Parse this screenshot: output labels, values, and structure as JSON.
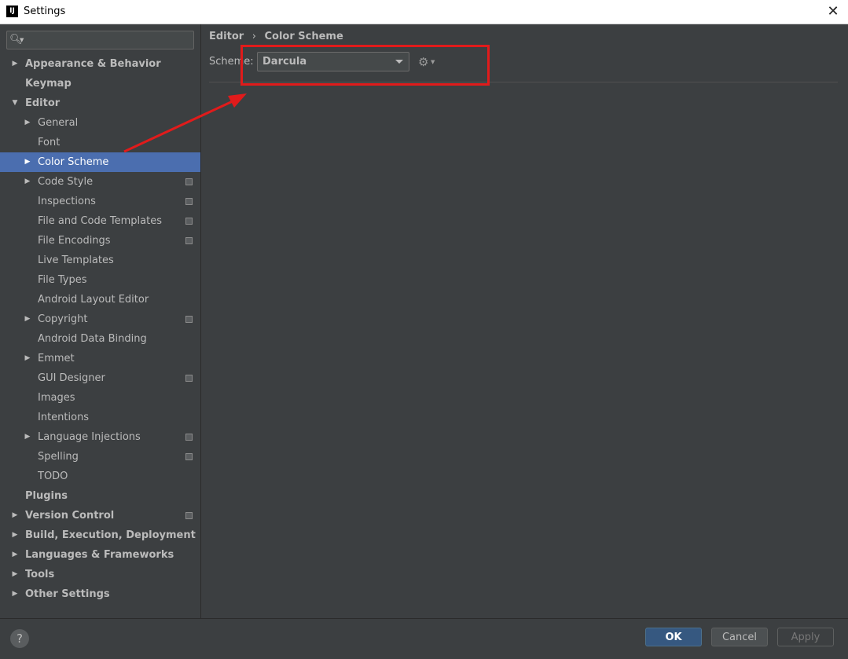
{
  "window": {
    "title": "Settings",
    "app_icon_text": "IJ",
    "close_glyph": "✕"
  },
  "search": {
    "value": "",
    "icon": "search-icon"
  },
  "tree": [
    {
      "label": "Appearance & Behavior",
      "level": 0,
      "bold": true,
      "expander": "collapsed"
    },
    {
      "label": "Keymap",
      "level": 0,
      "bold": true,
      "expander": "none"
    },
    {
      "label": "Editor",
      "level": 0,
      "bold": true,
      "expander": "expanded"
    },
    {
      "label": "General",
      "level": 1,
      "expander": "collapsed"
    },
    {
      "label": "Font",
      "level": 1,
      "expander": "none"
    },
    {
      "label": "Color Scheme",
      "level": 1,
      "expander": "collapsed",
      "selected": true
    },
    {
      "label": "Code Style",
      "level": 1,
      "expander": "collapsed",
      "project": true
    },
    {
      "label": "Inspections",
      "level": 1,
      "expander": "none",
      "project": true
    },
    {
      "label": "File and Code Templates",
      "level": 1,
      "expander": "none",
      "project": true
    },
    {
      "label": "File Encodings",
      "level": 1,
      "expander": "none",
      "project": true
    },
    {
      "label": "Live Templates",
      "level": 1,
      "expander": "none"
    },
    {
      "label": "File Types",
      "level": 1,
      "expander": "none"
    },
    {
      "label": "Android Layout Editor",
      "level": 1,
      "expander": "none"
    },
    {
      "label": "Copyright",
      "level": 1,
      "expander": "collapsed",
      "project": true
    },
    {
      "label": "Android Data Binding",
      "level": 1,
      "expander": "none"
    },
    {
      "label": "Emmet",
      "level": 1,
      "expander": "collapsed"
    },
    {
      "label": "GUI Designer",
      "level": 1,
      "expander": "none",
      "project": true
    },
    {
      "label": "Images",
      "level": 1,
      "expander": "none"
    },
    {
      "label": "Intentions",
      "level": 1,
      "expander": "none"
    },
    {
      "label": "Language Injections",
      "level": 1,
      "expander": "collapsed",
      "project": true
    },
    {
      "label": "Spelling",
      "level": 1,
      "expander": "none",
      "project": true
    },
    {
      "label": "TODO",
      "level": 1,
      "expander": "none"
    },
    {
      "label": "Plugins",
      "level": 0,
      "bold": true,
      "expander": "none"
    },
    {
      "label": "Version Control",
      "level": 0,
      "bold": true,
      "expander": "collapsed",
      "project": true
    },
    {
      "label": "Build, Execution, Deployment",
      "level": 0,
      "bold": true,
      "expander": "collapsed"
    },
    {
      "label": "Languages & Frameworks",
      "level": 0,
      "bold": true,
      "expander": "collapsed"
    },
    {
      "label": "Tools",
      "level": 0,
      "bold": true,
      "expander": "collapsed"
    },
    {
      "label": "Other Settings",
      "level": 0,
      "bold": true,
      "expander": "collapsed"
    }
  ],
  "content": {
    "breadcrumb": {
      "parent": "Editor",
      "separator": "›",
      "current": "Color Scheme"
    },
    "scheme": {
      "label": "Scheme:",
      "value": "Darcula"
    }
  },
  "buttons": {
    "help": "?",
    "ok": "OK",
    "cancel": "Cancel",
    "apply": "Apply"
  },
  "colors": {
    "annotation": "#e11b1b",
    "selection": "#4b6eaf",
    "background": "#3c3f41"
  }
}
